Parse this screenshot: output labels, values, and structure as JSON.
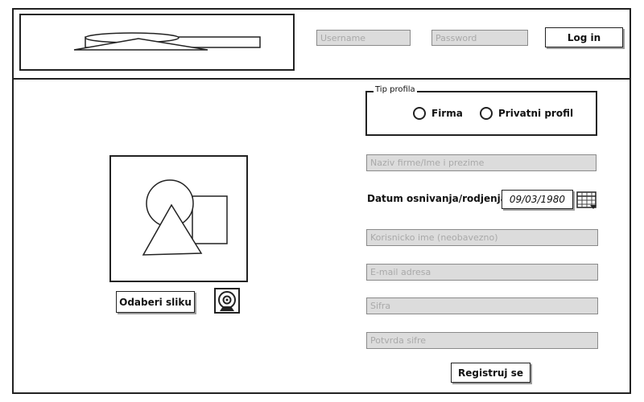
{
  "header": {
    "username_placeholder": "Username",
    "password_placeholder": "Password",
    "login_label": "Log in"
  },
  "profile_type": {
    "legend": "Tip profila",
    "options": [
      "Firma",
      "Privatni profil"
    ]
  },
  "form": {
    "name_placeholder": "Naziv firme/Ime i prezime",
    "date_label": "Datum osnivanja/rodjenja",
    "date_value": "09/03/1980",
    "username_placeholder": "Korisnicko ime (neobavezno)",
    "email_placeholder": "E-mail adresa",
    "password_placeholder": "Sifra",
    "confirm_placeholder": "Potvrda sifre",
    "register_label": "Registruj se"
  },
  "photo": {
    "choose_label": "Odaberi sliku"
  },
  "icons": {
    "logo": "logo-placeholder-icon",
    "image": "image-placeholder-icon",
    "calendar": "calendar-icon",
    "camera": "webcam-icon"
  }
}
